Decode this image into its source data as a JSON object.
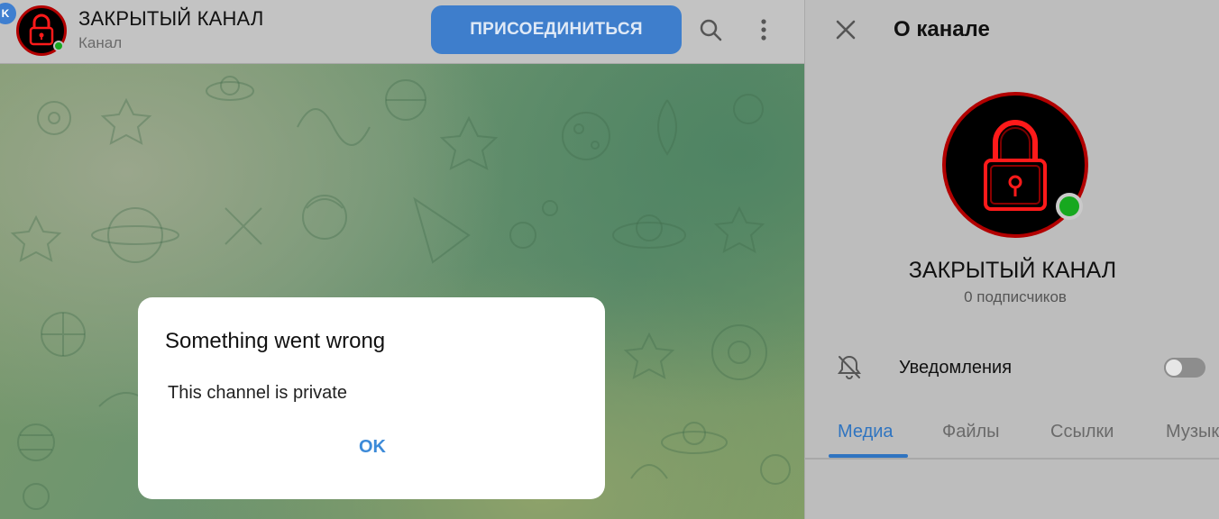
{
  "chat_header": {
    "unread_badge": "K",
    "title": "ЗАКРЫТЫЙ КАНАЛ",
    "subtitle": "Канал",
    "join_button": "ПРИСОЕДИНИТЬСЯ",
    "icons": [
      "search-icon",
      "more-vertical-icon"
    ]
  },
  "dialog": {
    "title": "Something went wrong",
    "message": "This channel is private",
    "ok_button": "OK"
  },
  "side_panel": {
    "title": "О канале",
    "channel_name": "ЗАКРЫТЫЙ КАНАЛ",
    "subscribers": "0 подписчиков",
    "notifications_label": "Уведомления",
    "notifications_enabled": false,
    "tabs": [
      {
        "label": "Медиа",
        "active": true
      },
      {
        "label": "Файлы",
        "active": false
      },
      {
        "label": "Ссылки",
        "active": false
      },
      {
        "label": "Музыка",
        "active": false
      }
    ]
  },
  "colors": {
    "accent": "#3e7ecc",
    "avatar_ring": "#b30000",
    "online": "#17a81f",
    "lock_neon": "#ff1a1a"
  }
}
